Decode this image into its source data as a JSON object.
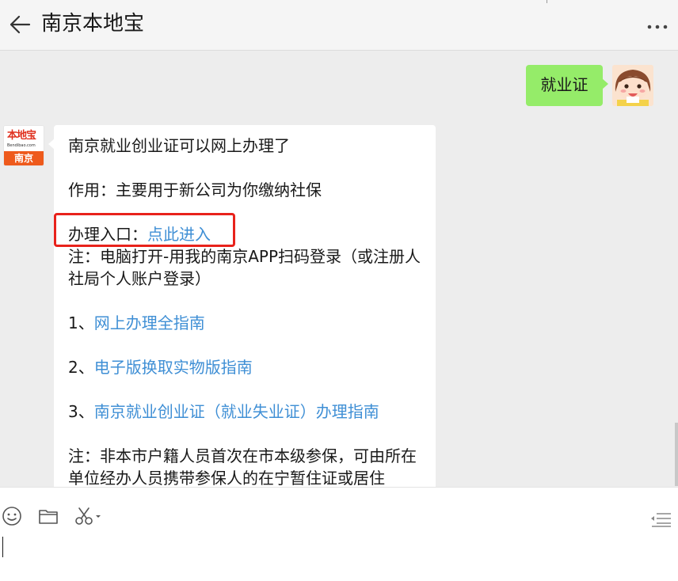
{
  "header": {
    "title": "南京本地宝",
    "back_icon": "back-arrow-icon",
    "more_icon": "more-options-icon"
  },
  "messages": {
    "outgoing": {
      "text": "就业证"
    },
    "incoming": {
      "avatar": {
        "brand": "本地宝",
        "site": "Bendibao.com",
        "city": "南京"
      },
      "line1": "南京就业创业证可以网上办理了",
      "line2": "作用：主要用于新公司为你缴纳社保",
      "entry_label": "办理入口：",
      "entry_link": "点此进入",
      "note1": "注：电脑打开-用我的南京APP扫码登录（或注册人社局个人账户登录）",
      "guide1_prefix": "1、",
      "guide1_link": "网上办理全指南",
      "guide2_prefix": "2、",
      "guide2_link": "电子版换取实物版指南",
      "guide3_prefix": "3、",
      "guide3_link": "南京就业创业证（就业失业证）办理指南",
      "note2": "注：非本市户籍人员首次在市本级参保，可由所在单位经办人员携带参保人的在宁暂住证或居住"
    }
  },
  "colors": {
    "link": "#3f8fd5",
    "outgoing_bubble": "#95ec69",
    "highlight_border": "#e8221b",
    "background": "#ededed"
  },
  "toolbar": {
    "icons": [
      "emoji-icon",
      "folder-icon",
      "scissors-icon",
      "chat-history-icon"
    ]
  }
}
